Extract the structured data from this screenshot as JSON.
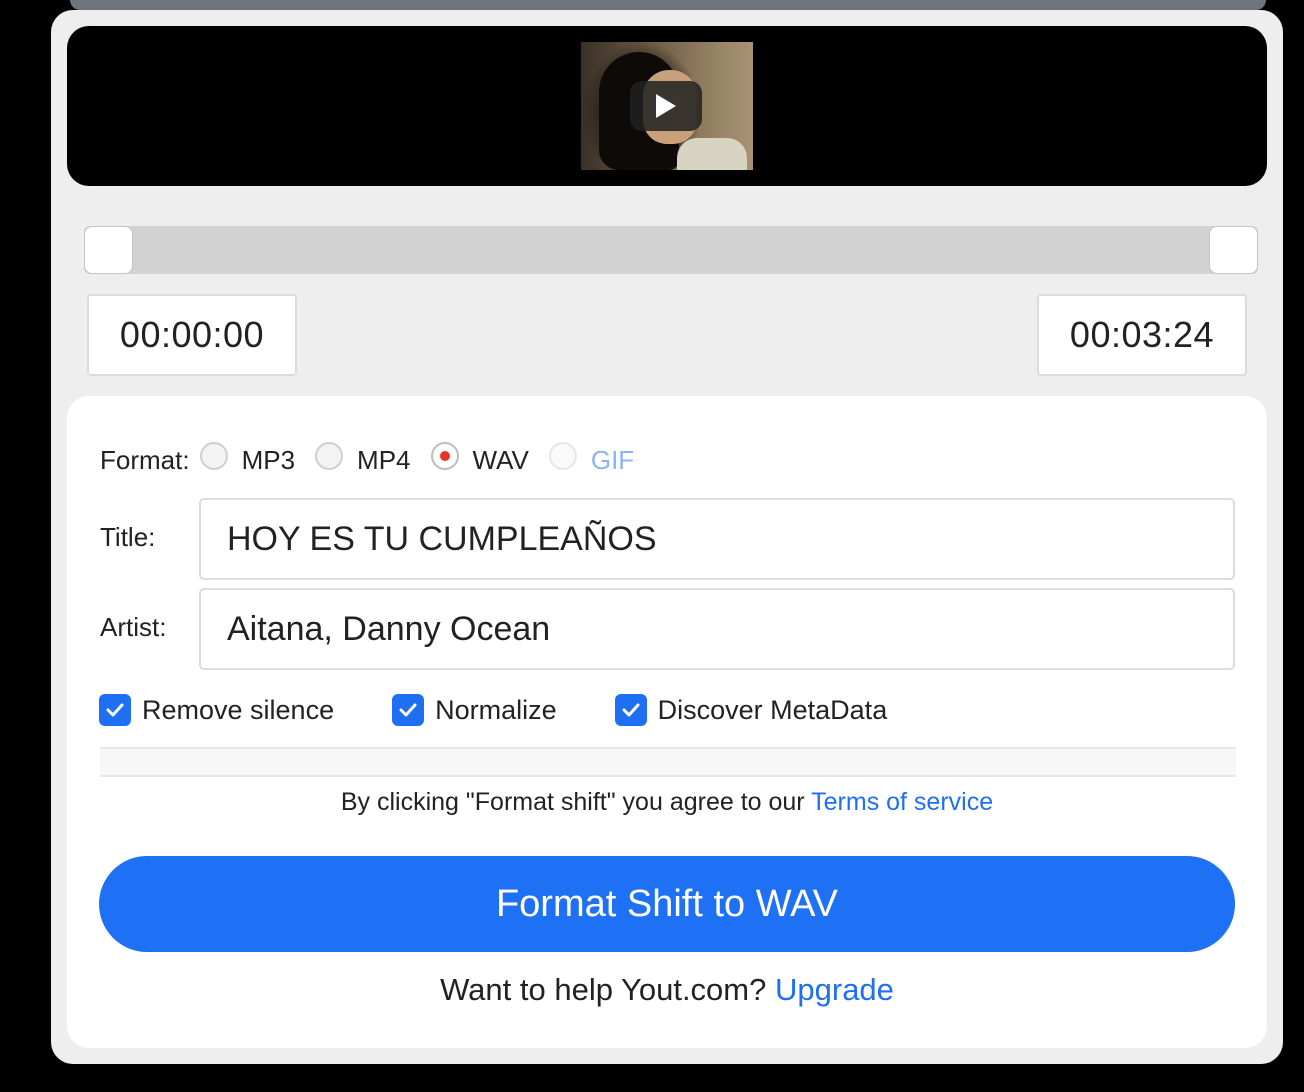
{
  "video": {
    "play_icon": "play-icon"
  },
  "trim": {
    "start_time": "00:00:00",
    "end_time": "00:03:24"
  },
  "format": {
    "label": "Format:",
    "options": [
      {
        "label": "MP3",
        "selected": false,
        "disabled": false
      },
      {
        "label": "MP4",
        "selected": false,
        "disabled": false
      },
      {
        "label": "WAV",
        "selected": true,
        "disabled": false
      },
      {
        "label": "GIF",
        "selected": false,
        "disabled": true
      }
    ]
  },
  "fields": {
    "title_label": "Title:",
    "title_value": "HOY ES TU CUMPLEAÑOS",
    "artist_label": "Artist:",
    "artist_value": "Aitana, Danny Ocean"
  },
  "options": {
    "remove_silence": "Remove silence",
    "normalize": "Normalize",
    "discover_metadata": "Discover MetaData"
  },
  "terms": {
    "text": "By clicking \"Format shift\" you agree to our",
    "link": "Terms of service"
  },
  "submit": {
    "label": "Format Shift to WAV"
  },
  "upgrade": {
    "text": "Want to help Yout.com?",
    "link": "Upgrade"
  },
  "colors": {
    "accent": "#1e70f5",
    "selected_radio": "#ea3323",
    "disabled_text": "#8bb4f0"
  }
}
